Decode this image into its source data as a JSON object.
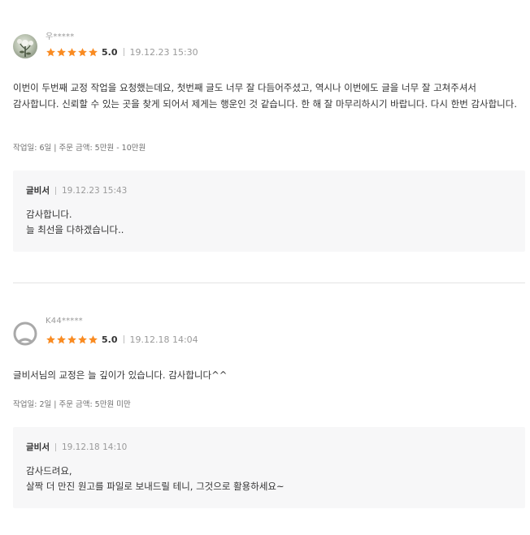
{
  "reviews": [
    {
      "reviewer": "우*****",
      "avatar": "flower-photo",
      "rating": 5,
      "score": "5.0",
      "date": "19.12.23 15:30",
      "text": "이번이 두번째 교정 작업을 요청했는데요, 첫번째 글도 너무 잘 다듬어주셨고, 역시나 이번에도 글을 너무 잘 고쳐주셔서 감사합니다. 신뢰할 수 있는 곳을 찾게 되어서 제게는 행운인 것 같습니다. 한 해 잘 마무리하시기 바랍니다. 다시 한번 감사합니다.",
      "order_info": "작업일: 6일 | 주문 금액: 5만원 - 10만원",
      "reply": {
        "author": "글비서",
        "date": "19.12.23 15:43",
        "lines": [
          "감사합니다.",
          "늘 최선을 다하겠습니다.."
        ]
      }
    },
    {
      "reviewer": "K44*****",
      "avatar": "default-user",
      "rating": 5,
      "score": "5.0",
      "date": "19.12.18 14:04",
      "text": "글비서님의 교정은 늘 깊이가 있습니다. 감사합니다^^",
      "order_info": "작업일: 2일 | 주문 금액: 5만원 미만",
      "reply": {
        "author": "글비서",
        "date": "19.12.18 14:10",
        "lines": [
          "감사드려요,",
          "살짝 더 만진 원고를 파일로 보내드릴 테니, 그것으로 활용하세요~"
        ]
      }
    }
  ],
  "colors": {
    "star": "#f98b22",
    "reply_bg": "#f7f7f8",
    "divider": "#e3e3e3"
  }
}
